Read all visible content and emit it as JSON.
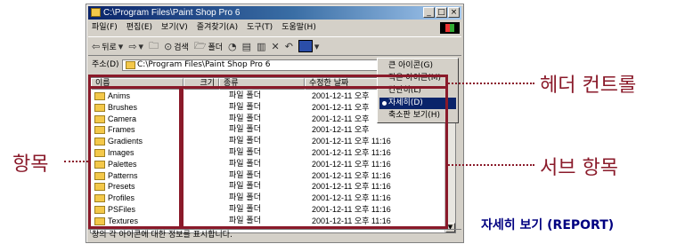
{
  "window": {
    "title": "C:\\Program Files\\Paint Shop Pro 6",
    "controls": [
      "_",
      "□",
      "×"
    ]
  },
  "menu": [
    "파일(F)",
    "편집(E)",
    "보기(V)",
    "즐겨찾기(A)",
    "도구(T)",
    "도움말(H)"
  ],
  "toolbar": {
    "back": "뒤로",
    "search": "검색",
    "folders": "폴더"
  },
  "address": {
    "label": "주소(D)",
    "value": "C:\\Program Files\\Paint Shop Pro 6"
  },
  "columns": [
    "이름",
    "크기",
    "종류",
    "수정한 날짜"
  ],
  "files": [
    {
      "name": "Anims",
      "type": "파일 폴더",
      "date": "2001-12-11 오후"
    },
    {
      "name": "Brushes",
      "type": "파일 폴더",
      "date": "2001-12-11 오후"
    },
    {
      "name": "Camera",
      "type": "파일 폴더",
      "date": "2001-12-11 오후"
    },
    {
      "name": "Frames",
      "type": "파일 폴더",
      "date": "2001-12-11 오후"
    },
    {
      "name": "Gradients",
      "type": "파일 폴더",
      "date": "2001-12-11 오후 11:16"
    },
    {
      "name": "Images",
      "type": "파일 폴더",
      "date": "2001-12-11 오후 11:16"
    },
    {
      "name": "Palettes",
      "type": "파일 폴더",
      "date": "2001-12-11 오후 11:16"
    },
    {
      "name": "Patterns",
      "type": "파일 폴더",
      "date": "2001-12-11 오후 11:16"
    },
    {
      "name": "Presets",
      "type": "파일 폴더",
      "date": "2001-12-11 오후 11:16"
    },
    {
      "name": "Profiles",
      "type": "파일 폴더",
      "date": "2001-12-11 오후 11:16"
    },
    {
      "name": "PSFiles",
      "type": "파일 폴더",
      "date": "2001-12-11 오후 11:16"
    },
    {
      "name": "Textures",
      "type": "파일 폴더",
      "date": "2001-12-11 오후 11:16"
    }
  ],
  "view_menu": [
    {
      "label": "큰 아이콘(G)",
      "selected": false
    },
    {
      "label": "작은 아이콘(M)",
      "selected": false
    },
    {
      "label": "간단히(L)",
      "selected": false
    },
    {
      "label": "자세히(D)",
      "selected": true
    },
    {
      "label": "축소판 보기(H)",
      "selected": false
    }
  ],
  "status": "창의 각 아이콘에 대한 정보를 표시합니다.",
  "annotations": {
    "header_control": "헤더 컨트롤",
    "item": "항목",
    "subitem": "서브 항목",
    "caption": "자세히 보기 (REPORT)"
  },
  "colors": {
    "annotation": "#8a1a2a",
    "caption": "#000080",
    "titlebar": "#0a246a",
    "window": "#d4d0c8"
  }
}
